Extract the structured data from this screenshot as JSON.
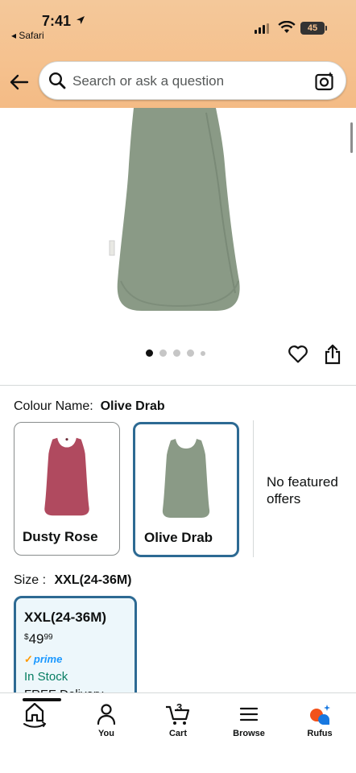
{
  "status_bar": {
    "time": "7:41",
    "back_app": "◂ Safari",
    "battery": "45"
  },
  "search": {
    "placeholder": "Search or ask a question"
  },
  "gallery": {
    "image_count": 5,
    "active_index": 0
  },
  "colour": {
    "label": "Colour Name:",
    "selected": "Olive Drab",
    "options": [
      {
        "name": "Dusty Rose",
        "color": "#b04a5f"
      },
      {
        "name": "Olive Drab",
        "color": "#8a9a86"
      }
    ],
    "no_offers": "No featured offers"
  },
  "size": {
    "label": "Size :",
    "selected": "XXL(24-36M)",
    "card": {
      "name": "XXL(24-36M)",
      "price_currency": "$",
      "price_whole": "49",
      "price_cents": "99",
      "prime": "prime",
      "stock": "In Stock",
      "delivery": "FREE Delivery"
    }
  },
  "tabs": {
    "home": "",
    "you": "You",
    "cart": "Cart",
    "cart_count": "3",
    "browse": "Browse",
    "rufus": "Rufus"
  },
  "colors": {
    "header": "#f5c18e",
    "selected_border": "#2d6a93",
    "in_stock": "#067d62",
    "prime": "#1a98ff",
    "product": "#8a9a86"
  }
}
